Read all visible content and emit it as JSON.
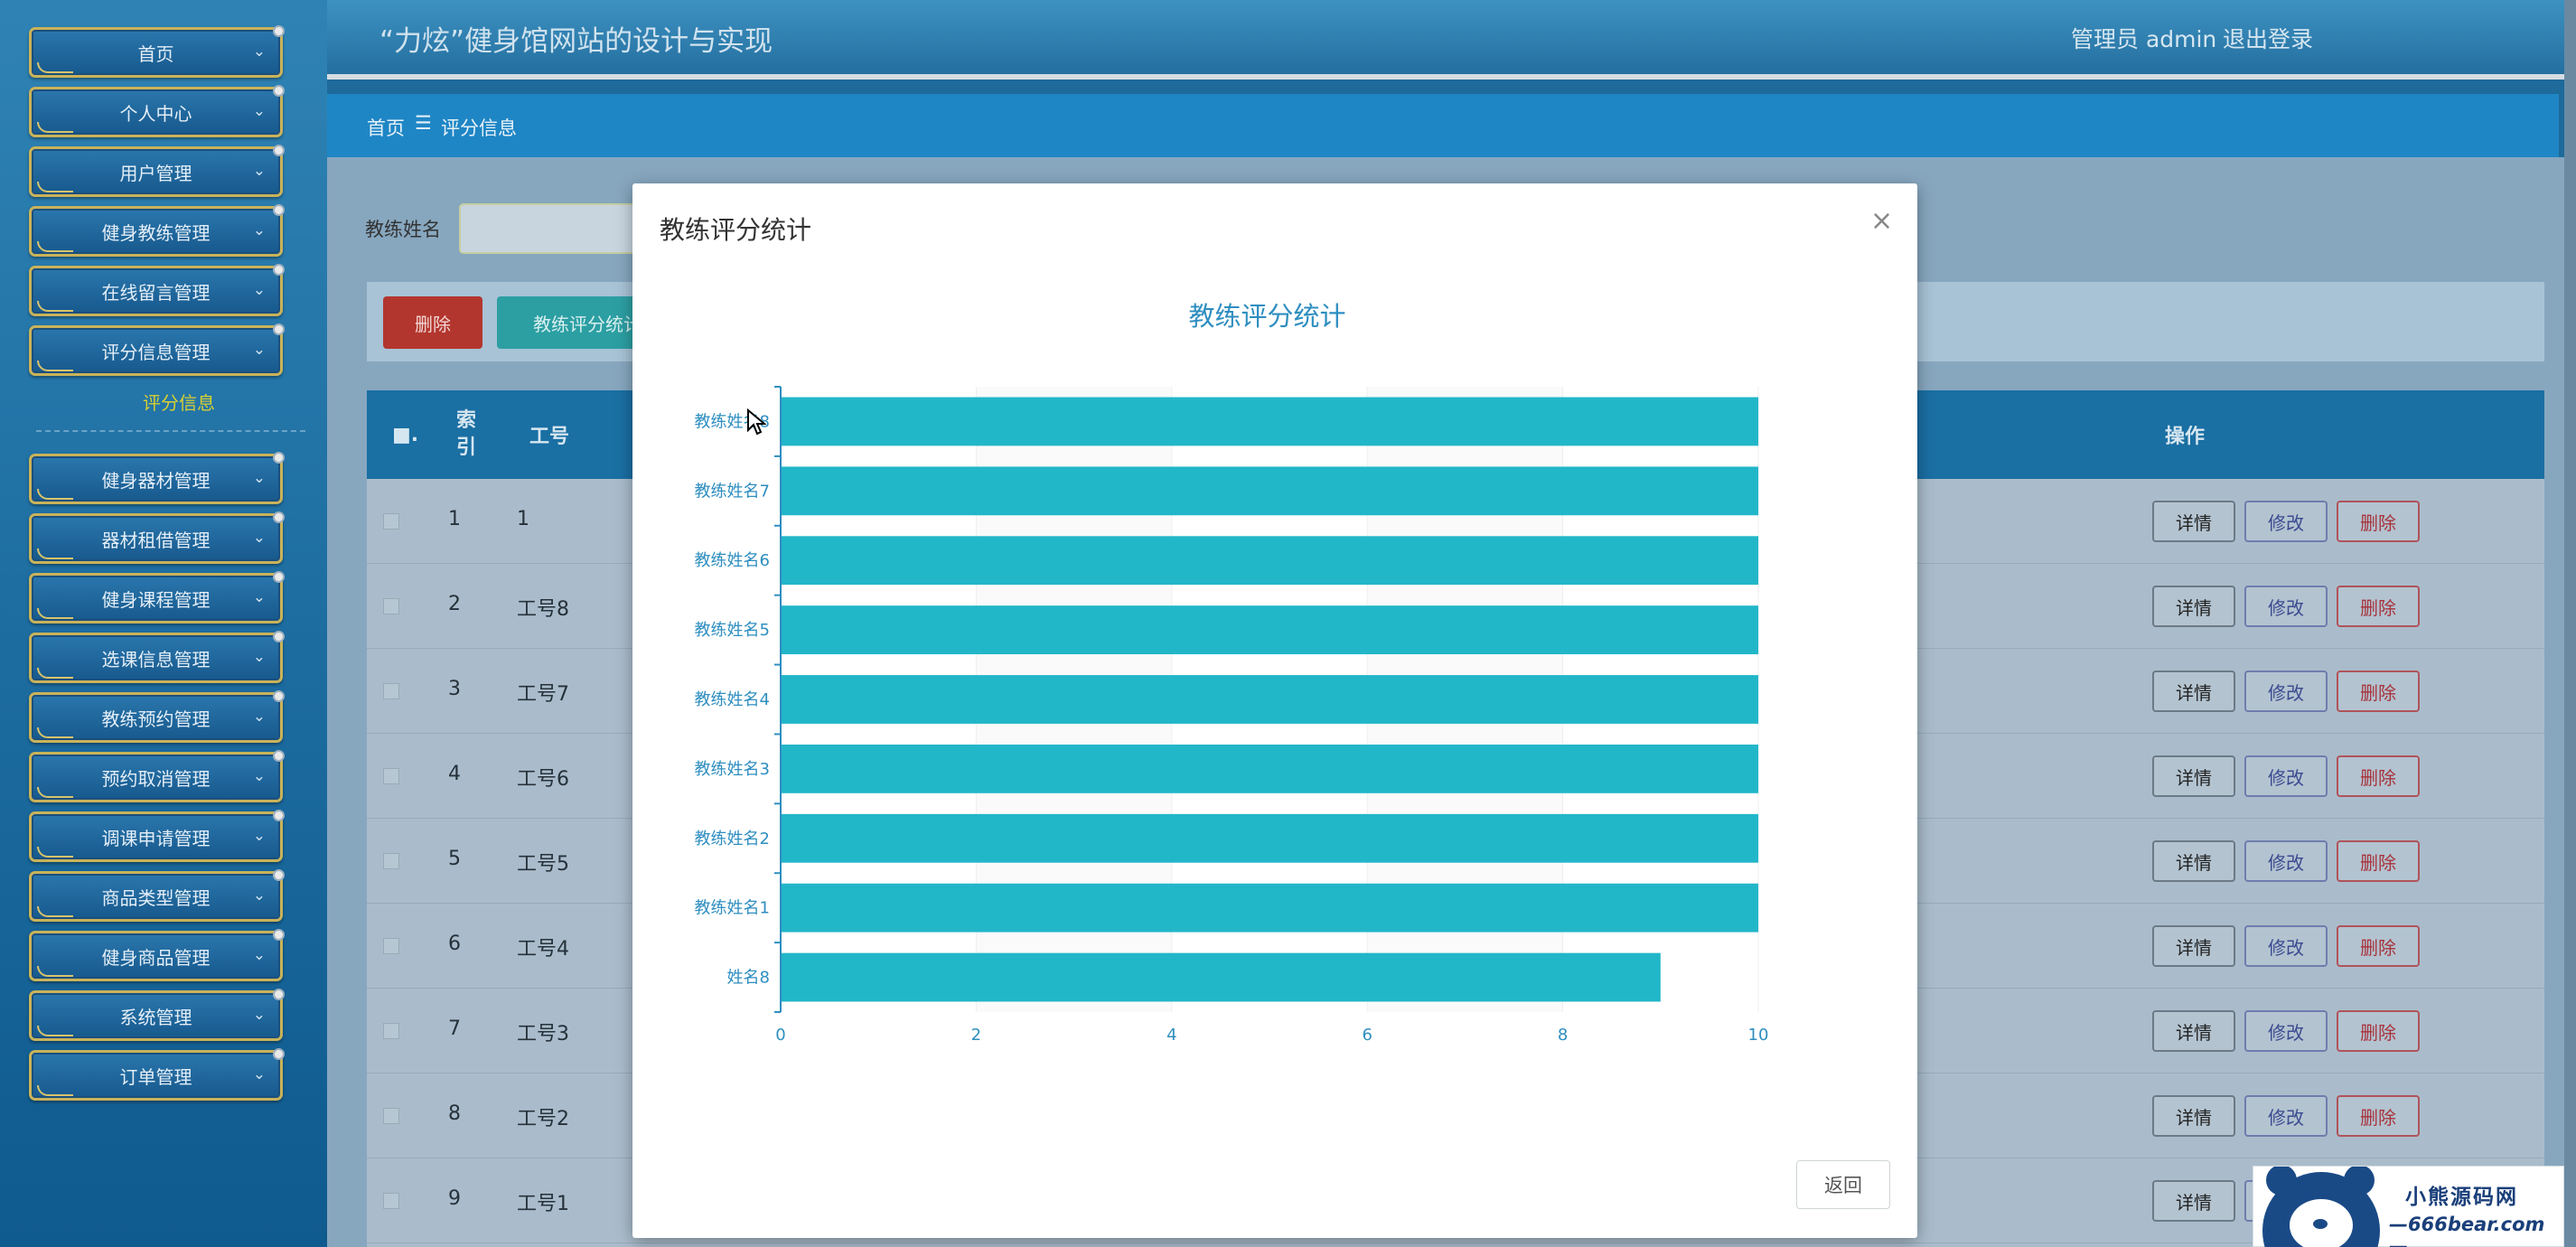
{
  "app": {
    "title": "“力炫”健身馆网站的设计与实现",
    "admin_label": "管理员 admin",
    "logout": "退出登录"
  },
  "sidebar": {
    "items": [
      "首页",
      "个人中心",
      "用户管理",
      "健身教练管理",
      "在线留言管理",
      "评分信息管理",
      "健身器材管理",
      "器材租借管理",
      "健身课程管理",
      "选课信息管理",
      "教练预约管理",
      "预约取消管理",
      "调课申请管理",
      "商品类型管理",
      "健身商品管理",
      "系统管理",
      "订单管理"
    ],
    "submenu_label": "评分信息"
  },
  "breadcrumb": {
    "home": "首页",
    "separator": "☰",
    "current": "评分信息"
  },
  "search": {
    "label": "教练姓名"
  },
  "actions": {
    "delete": "删除",
    "stats": "教练评分统计"
  },
  "table": {
    "headers": {
      "check": "■.",
      "index": "索引",
      "job_no": "工号",
      "ops": "操作"
    },
    "rows": [
      {
        "index": "1",
        "job_no": "1"
      },
      {
        "index": "2",
        "job_no": "工号8"
      },
      {
        "index": "3",
        "job_no": "工号7"
      },
      {
        "index": "4",
        "job_no": "工号6"
      },
      {
        "index": "5",
        "job_no": "工号5"
      },
      {
        "index": "6",
        "job_no": "工号4"
      },
      {
        "index": "7",
        "job_no": "工号3"
      },
      {
        "index": "8",
        "job_no": "工号2"
      },
      {
        "index": "9",
        "job_no": "工号1"
      }
    ],
    "op_labels": {
      "detail": "详情",
      "edit": "修改",
      "remove": "删除"
    }
  },
  "modal": {
    "title": "教练评分统计",
    "close": "×",
    "back": "返回"
  },
  "chart_data": {
    "type": "bar",
    "orientation": "horizontal",
    "title": "教练评分统计",
    "categories": [
      "教练姓名8",
      "教练姓名7",
      "教练姓名6",
      "教练姓名5",
      "教练姓名4",
      "教练姓名3",
      "教练姓名2",
      "教练姓名1",
      "姓名8"
    ],
    "values": [
      10,
      10,
      10,
      10,
      10,
      10,
      10,
      10,
      9
    ],
    "xlim": [
      0,
      10
    ],
    "xticks": [
      0,
      2,
      4,
      6,
      8,
      10
    ],
    "bar_color": "#22b6c9",
    "axis_color": "#2e8ec0",
    "grid": true
  },
  "watermark": {
    "line1": "小熊源码网",
    "line2": "—666bear.com—"
  },
  "colors": {
    "accent": "#1f86c5",
    "danger": "#b3362e",
    "teal": "#2c9fa3"
  }
}
